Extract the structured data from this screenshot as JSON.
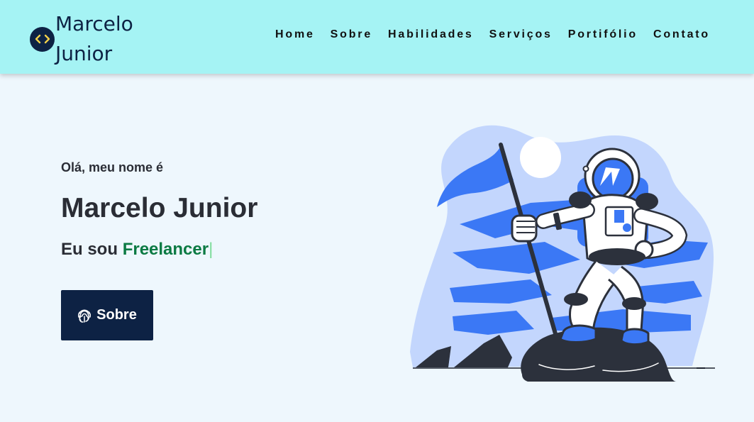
{
  "brand": {
    "name": "Marcelo Junior",
    "icon": "code-icon"
  },
  "nav": {
    "items": [
      "Home",
      "Sobre",
      "Habilidades",
      "Serviços",
      "Portifólio",
      "Contato"
    ]
  },
  "hero": {
    "greeting": "Olá, meu nome é",
    "name": "Marcelo Junior",
    "role_prefix": "Eu sou",
    "role_highlight": "Freelancer",
    "cursor": "|",
    "button_label": "Sobre",
    "button_icon": "fingerprint-icon"
  },
  "colors": {
    "nav_bg": "#a5f3f4",
    "page_bg": "#eef7fd",
    "dark_navy": "#0d2244",
    "highlight_green": "#0b7a43",
    "illustration_blue": "#3b78f5",
    "illustration_light": "#c3d6fd"
  }
}
